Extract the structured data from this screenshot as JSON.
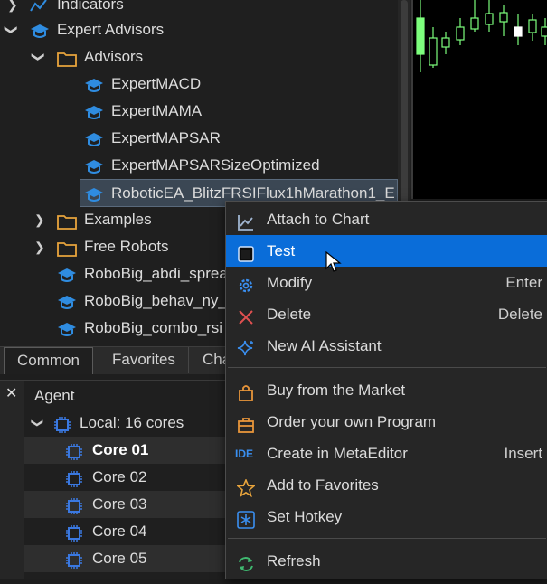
{
  "navigator": {
    "items": [
      {
        "label": "Indicators"
      },
      {
        "label": "Expert Advisors"
      },
      {
        "label": "Advisors"
      },
      {
        "label": "ExpertMACD"
      },
      {
        "label": "ExpertMAMA"
      },
      {
        "label": "ExpertMAPSAR"
      },
      {
        "label": "ExpertMAPSARSizeOptimized"
      },
      {
        "label": "RoboticEA_BlitzFRSIFlux1hMarathon1_E"
      },
      {
        "label": "Examples"
      },
      {
        "label": "Free Robots"
      },
      {
        "label": "RoboBig_abdi_spread"
      },
      {
        "label": "RoboBig_behav_ny_"
      },
      {
        "label": "RoboBig_combo_rsi"
      }
    ]
  },
  "tabs": [
    {
      "label": "Common"
    },
    {
      "label": "Favorites"
    },
    {
      "label": "Cha"
    }
  ],
  "agents": {
    "close": "✕",
    "header": "Agent",
    "group": "Local: 16 cores",
    "cores": [
      "Core 01",
      "Core 02",
      "Core 03",
      "Core 04",
      "Core 05"
    ]
  },
  "context_menu": {
    "items": [
      {
        "label": "Attach to Chart",
        "shortcut": ""
      },
      {
        "label": "Test",
        "shortcut": ""
      },
      {
        "label": "Modify",
        "shortcut": "Enter"
      },
      {
        "label": "Delete",
        "shortcut": "Delete"
      },
      {
        "label": "New AI Assistant",
        "shortcut": ""
      },
      {
        "label": "Buy from the Market",
        "shortcut": ""
      },
      {
        "label": "Order your own Program",
        "shortcut": ""
      },
      {
        "label": "Create in MetaEditor",
        "shortcut": "Insert"
      },
      {
        "label": "Add to Favorites",
        "shortcut": ""
      },
      {
        "label": "Set Hotkey",
        "shortcut": ""
      },
      {
        "label": "Refresh",
        "shortcut": ""
      }
    ],
    "ide_badge": "IDE"
  },
  "colors": {
    "highlight": "#0a6dd9",
    "ea_icon": "#2f8ce0",
    "folder": "#e8a43c",
    "core_icon": "#3a78e0",
    "delete_red": "#e05050",
    "buy_orange": "#e8953a",
    "favorite_star": "#e8a43c",
    "refresh_green": "#3fb970",
    "candle_green": "#7dff7d"
  }
}
